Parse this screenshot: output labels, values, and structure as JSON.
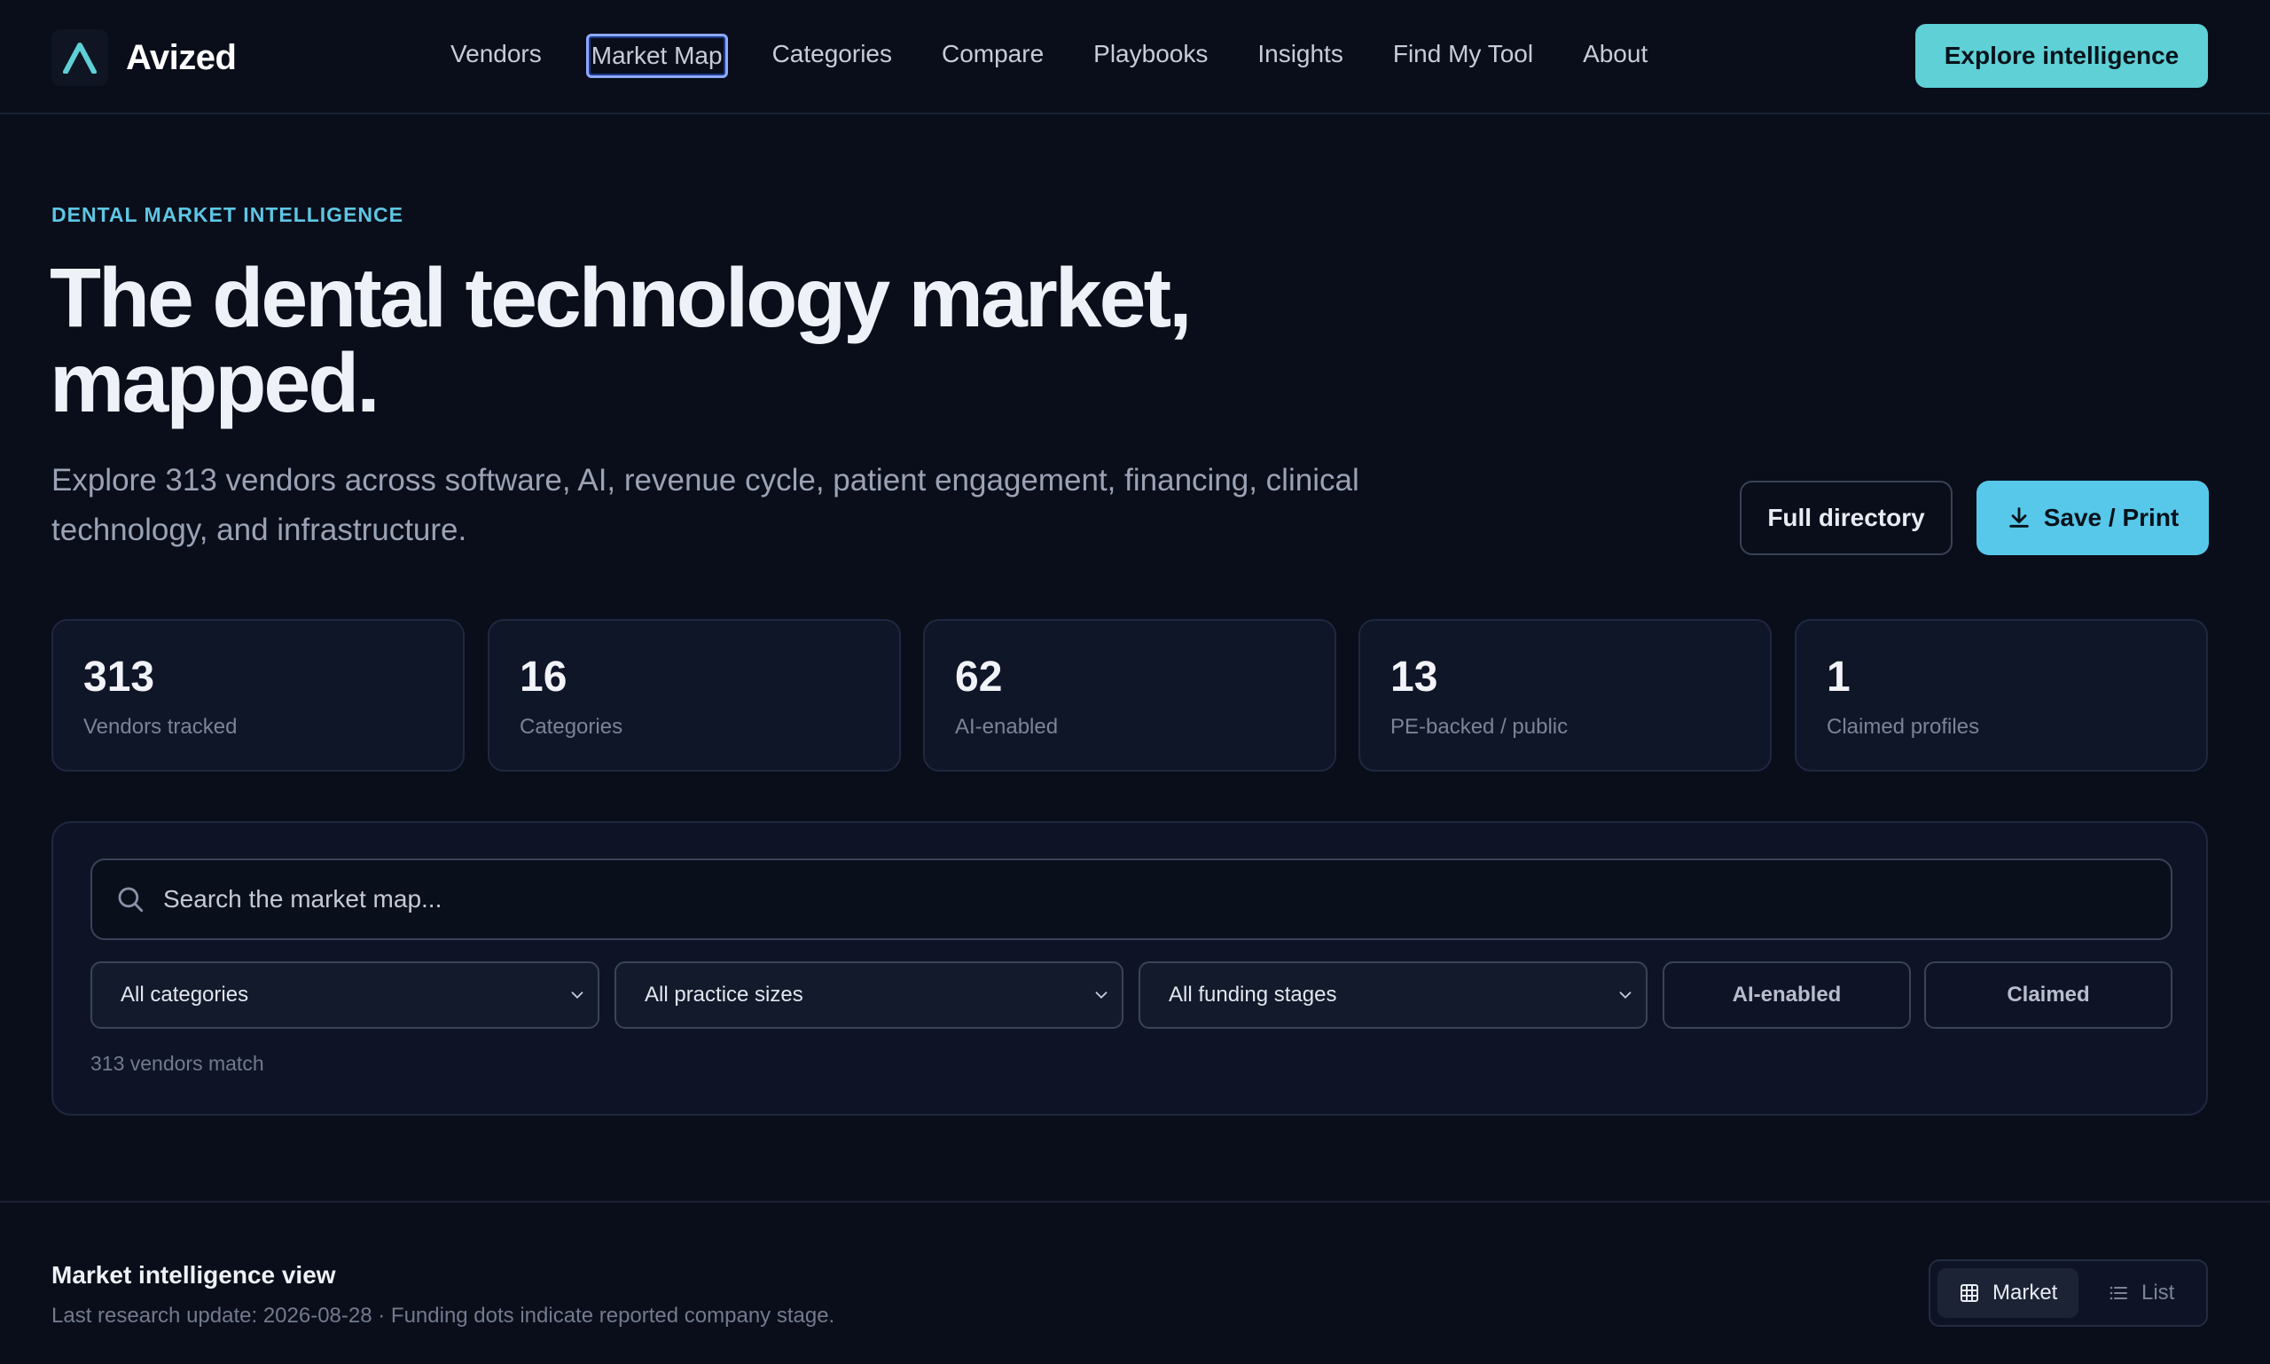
{
  "brand": {
    "name": "Avized"
  },
  "nav": {
    "links": [
      "Vendors",
      "Market Map",
      "Categories",
      "Compare",
      "Playbooks",
      "Insights",
      "Find My Tool",
      "About"
    ],
    "cta": "Explore intelligence"
  },
  "hero": {
    "eyebrow": "DENTAL MARKET INTELLIGENCE",
    "title_line1": "The dental technology market,",
    "title_line2": "mapped.",
    "subtitle": "Explore 313 vendors across software, AI, revenue cycle, patient engagement, financing, clinical technology, and infrastructure.",
    "btn_directory": "Full directory",
    "btn_save": "Save / Print"
  },
  "stats": [
    {
      "value": "313",
      "label": "Vendors tracked"
    },
    {
      "value": "16",
      "label": "Categories"
    },
    {
      "value": "62",
      "label": "AI-enabled"
    },
    {
      "value": "13",
      "label": "PE-backed / public"
    },
    {
      "value": "1",
      "label": "Claimed profiles"
    }
  ],
  "filters": {
    "search_placeholder": "Search the market map...",
    "category": "All categories",
    "practice_size": "All practice sizes",
    "funding": "All funding stages",
    "toggle_ai": "AI-enabled",
    "toggle_claimed": "Claimed",
    "match_text": "313 vendors match"
  },
  "view": {
    "title": "Market intelligence view",
    "subtitle": "Last research update: 2026-08-28 · Funding dots indicate reported company stage.",
    "market_label": "Market",
    "list_label": "List"
  },
  "colors": {
    "accent": "#5ed0d6",
    "primary_button": "#57c8ea",
    "background": "#0a0e1a"
  }
}
